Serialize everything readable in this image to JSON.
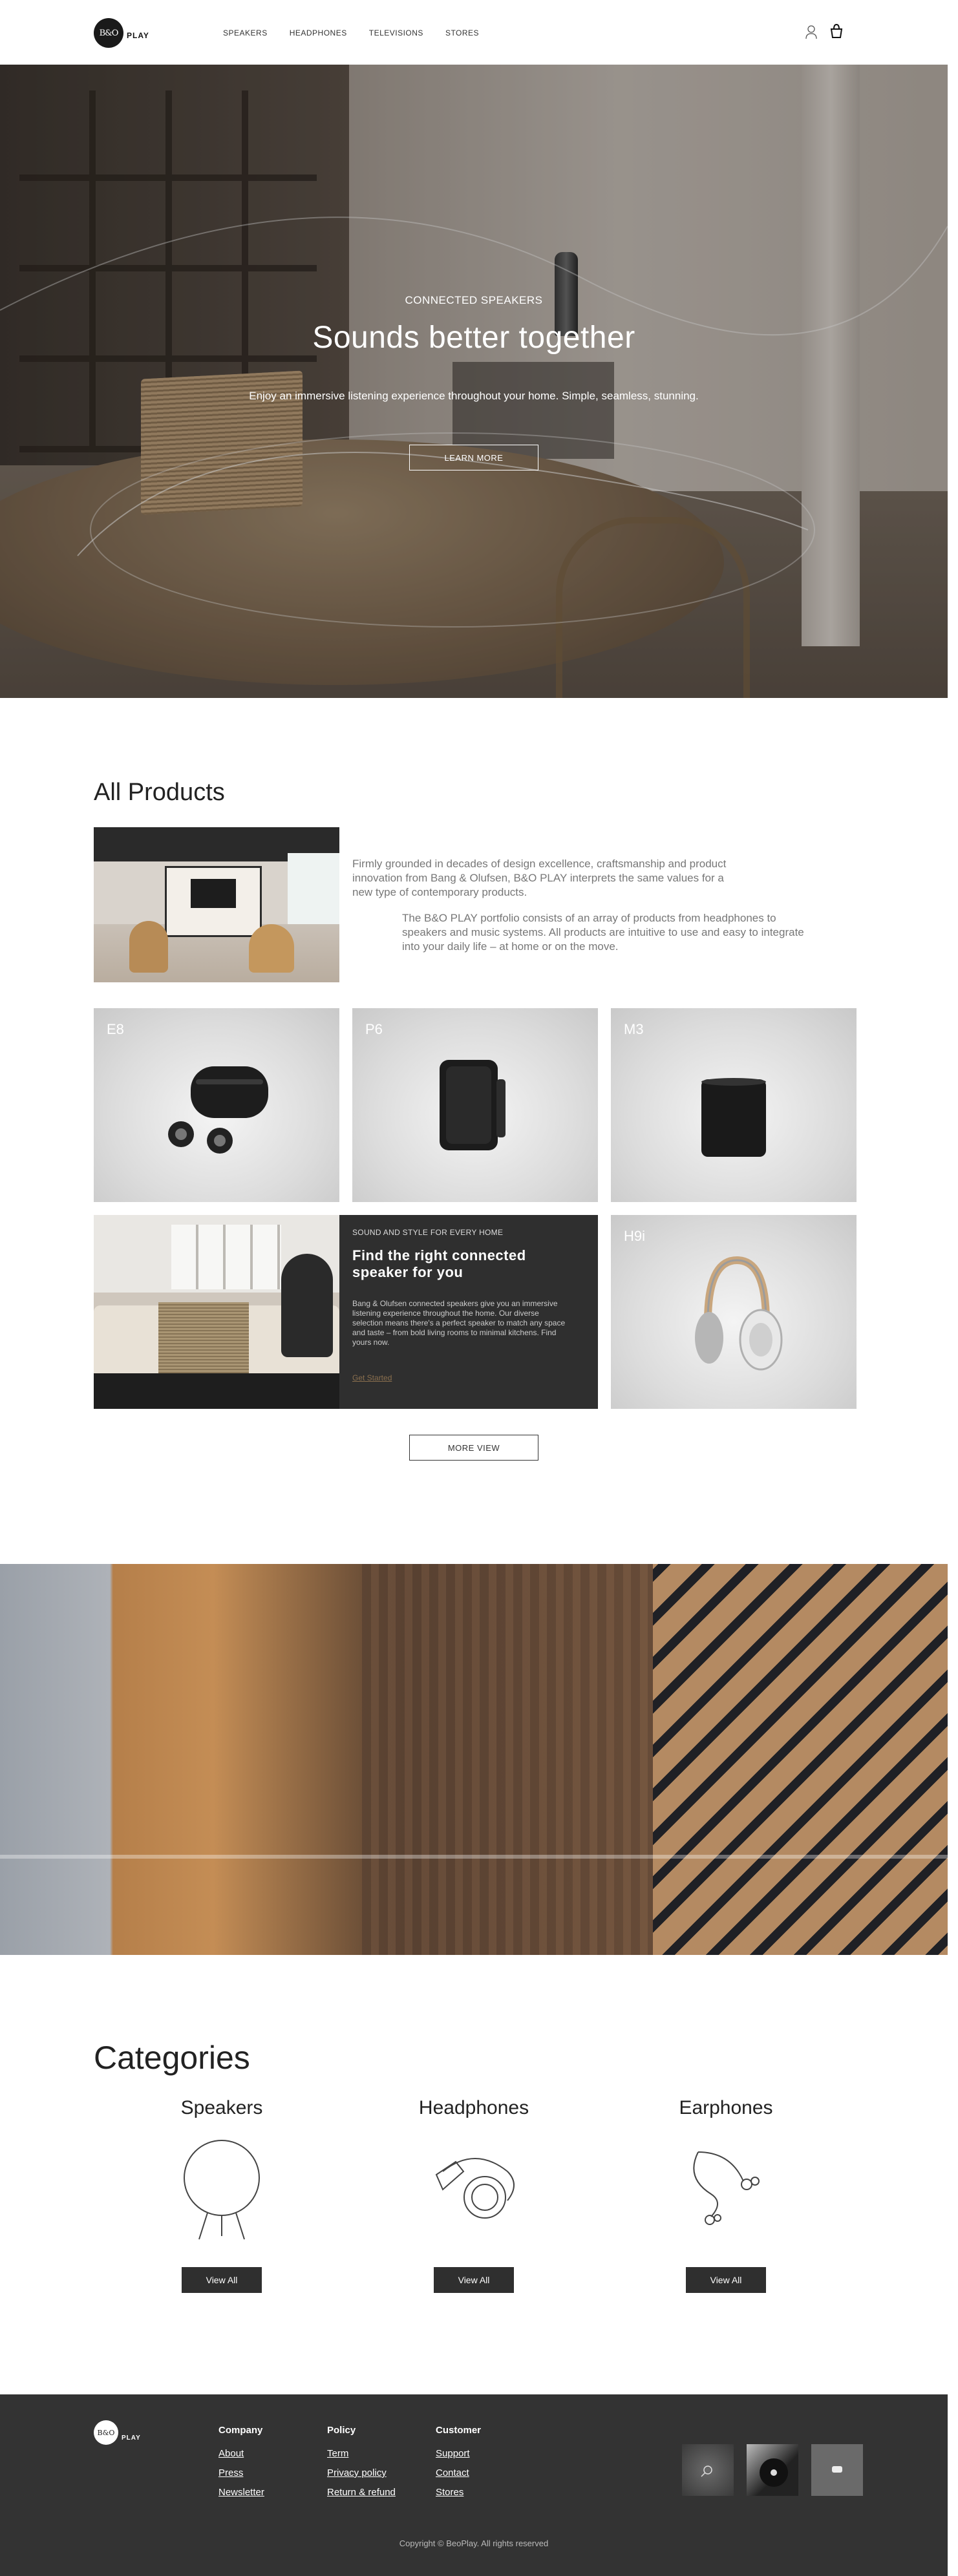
{
  "header": {
    "logo_mark": "B&O",
    "logo_text": "PLAY",
    "nav": [
      "SPEAKERS",
      "HEADPHONES",
      "TELEVISIONS",
      "STORES"
    ]
  },
  "hero": {
    "eyebrow": "CONNECTED SPEAKERS",
    "title": "Sounds better together",
    "text": "Enjoy an immersive listening experience throughout your home. Simple, seamless, stunning.",
    "button": "LEARN MORE"
  },
  "products": {
    "title": "All Products",
    "intro_1": "Firmly grounded in decades of design excellence, craftsmanship and product innovation from Bang & Olufsen, B&O PLAY interprets the same values for a new type of contemporary products.",
    "intro_2": "The B&O PLAY portfolio consists of an array of products from headphones to speakers and music systems. All products are intuitive to use and easy to integrate into your daily life – at home or on the move.",
    "cards": [
      "E8",
      "P6",
      "M3",
      "H9i"
    ],
    "feature": {
      "eyebrow": "SOUND AND STYLE FOR EVERY HOME",
      "title": "Find the right connected speaker for you",
      "text": "Bang & Olufsen connected speakers give you an immersive listening experience throughout the home. Our diverse selection means there's a perfect speaker to match any space and taste – from bold living rooms to minimal kitchens. Find yours now.",
      "link": "Get Started"
    },
    "more_button": "MORE VIEW"
  },
  "categories": {
    "title": "Categories",
    "items": [
      {
        "name": "Speakers",
        "button": "View All",
        "icon": "speaker-icon"
      },
      {
        "name": "Headphones",
        "button": "View All",
        "icon": "headphones-icon"
      },
      {
        "name": "Earphones",
        "button": "View All",
        "icon": "earphones-icon"
      }
    ]
  },
  "footer": {
    "logo_mark": "B&O",
    "logo_text": "PLAY",
    "columns": [
      {
        "heading": "Company",
        "links": [
          "About",
          "Press",
          "Newsletter"
        ]
      },
      {
        "heading": "Policy",
        "links": [
          "Term",
          "Privacy policy",
          "Return & refund"
        ]
      },
      {
        "heading": "Customer",
        "links": [
          "Support",
          "Contact",
          "Stores"
        ]
      }
    ],
    "copyright": "Copyright © BeoPlay. All rights reserved"
  },
  "colors": {
    "dark": "#2f2f2f",
    "footer": "#333333",
    "accent_link": "#8a6f4e"
  }
}
